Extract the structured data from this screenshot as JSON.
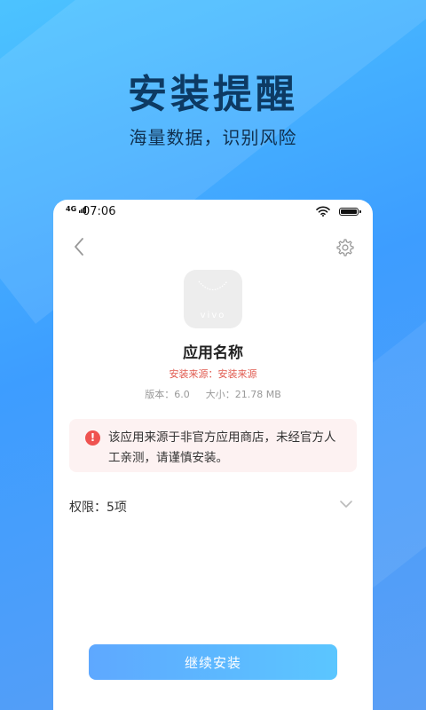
{
  "hero": {
    "title": "安装提醒",
    "subtitle": "海量数据，识别风险"
  },
  "status_bar": {
    "network": "4G",
    "time": "07:06",
    "icons": [
      "signal-icon",
      "wifi-icon",
      "battery-icon"
    ]
  },
  "header": {
    "back_icon": "chevron-left-icon",
    "settings_icon": "gear-icon"
  },
  "app": {
    "icon_brand": "vivo",
    "name": "应用名称",
    "source": "安装来源：安装来源",
    "version": "版本：6.0",
    "size": "大小：21.78 MB"
  },
  "warning": {
    "icon": "exclamation-icon",
    "text": "该应用来源于非官方应用商店，未经官方人工亲测，请谨慎安装。"
  },
  "permissions": {
    "label": "权限：5项",
    "icon": "chevron-down-icon"
  },
  "actions": {
    "install_label": "继续安装"
  },
  "colors": {
    "accent": "#5ea8ff",
    "warning": "#ef5350",
    "warning_bg": "#fdf2f2",
    "source_text": "#e05a4f"
  }
}
